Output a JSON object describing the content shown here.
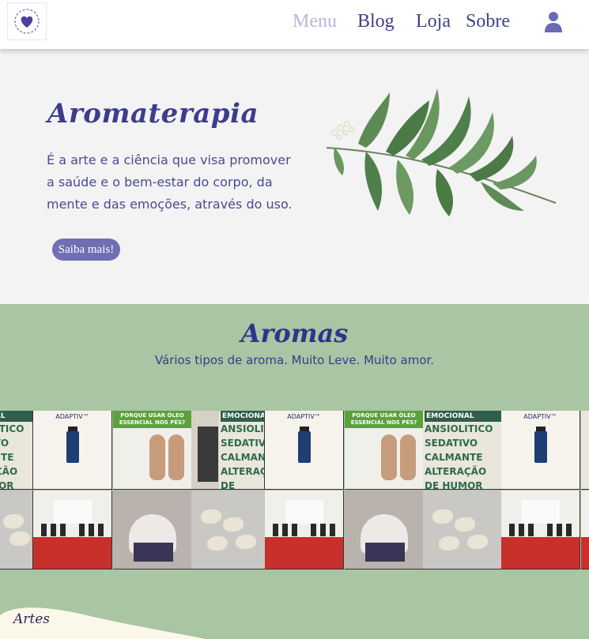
{
  "header": {
    "logo": "heart-wreath-logo",
    "nav": [
      {
        "label": "Menu",
        "active": true
      },
      {
        "label": "Blog",
        "active": false
      },
      {
        "label": "Loja",
        "active": false
      },
      {
        "label": "Sobre",
        "active": false
      }
    ],
    "user_icon": "user-icon"
  },
  "hero": {
    "title": "Aromaterapia",
    "text": "É a arte e a ciência que visa promover a saúde e o bem-estar do corpo, da mente e das emoções, através do uso.",
    "button_label": "Saiba mais!",
    "illustration": "olive-branch"
  },
  "aromas": {
    "title": "Aromas",
    "subtitle": "Vários tipos de aroma. Muito Leve. Muito amor.",
    "cards": {
      "sedativo": {
        "header": "EMOCIONAL",
        "lines": [
          "ANSIOLITICO",
          "SEDATIVO",
          "CALMANTE",
          "ALTERAÇÃO",
          "DE HUMOR"
        ]
      },
      "adaptiv": {
        "title": "ADAPTIV™"
      },
      "feet": {
        "header": "PORQUE USAR ÓLEO ESSENCIAL NOS PÉS?"
      }
    }
  },
  "artes": {
    "label": "Artes"
  },
  "colors": {
    "accent": "#3d3d8c",
    "button": "#6f6fb3",
    "green_band": "#a9c5a3",
    "nav_active": "#b6b6d8"
  }
}
